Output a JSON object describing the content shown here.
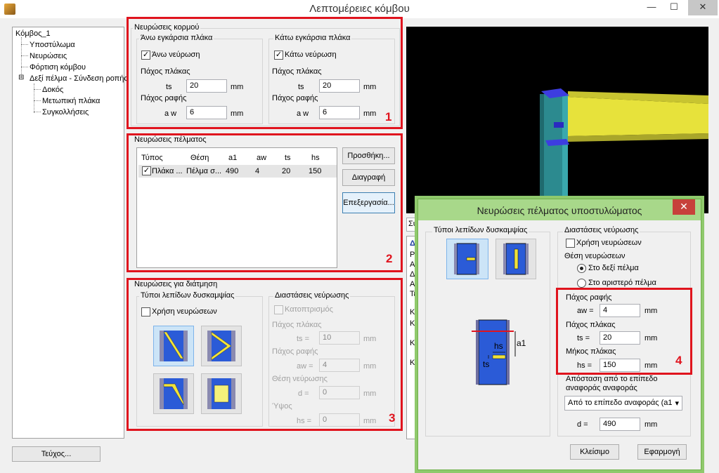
{
  "window": {
    "title": "Λεπτομέρειες κόμβου",
    "minimize": "—",
    "maximize": "☐",
    "close": "✕"
  },
  "tree": {
    "items": [
      "Κόμβος_1",
      "Υποστύλωμα",
      "Νευρώσεις",
      "Φόρτιση κόμβου",
      "Δεξί πέλμα - Σύνδεση ροπής",
      "Δοκός",
      "Μετωπική πλάκα",
      "Συγκολλήσεις"
    ],
    "expander": "⊟"
  },
  "footer": {
    "report_button": "Τεύχος..."
  },
  "web_stiffeners": {
    "title": "Νευρώσεις κορμού",
    "top": {
      "title": "Άνω εγκάρσια πλάκα",
      "checkbox": "Άνω νεύρωση",
      "checked": true,
      "thickness_label": "Πάχος πλάκας",
      "ts_label": "ts",
      "ts_value": "20",
      "ts_unit": "mm",
      "weld_label": "Πάχος ραφής",
      "aw_label": "a w",
      "aw_value": "6",
      "aw_unit": "mm"
    },
    "bottom": {
      "title": "Κάτω εγκάρσια πλάκα",
      "checkbox": "Κάτω νεύρωση",
      "checked": true,
      "thickness_label": "Πάχος πλάκας",
      "ts_label": "ts",
      "ts_value": "20",
      "ts_unit": "mm",
      "weld_label": "Πάχος ραφής",
      "aw_label": "a w",
      "aw_value": "6",
      "aw_unit": "mm"
    },
    "marker": "1"
  },
  "flange_stiffeners": {
    "title": "Νευρώσεις πέλματος",
    "columns": [
      "Τύπος",
      "Θέση",
      "a1",
      "aw",
      "ts",
      "hs"
    ],
    "rows": [
      {
        "type": "Πλάκα ...",
        "position": "Πέλμα σ...",
        "a1": "490",
        "aw": "4",
        "ts": "20",
        "hs": "150",
        "checked": true
      }
    ],
    "buttons": {
      "add": "Προσθήκη...",
      "delete": "Διαγραφή",
      "edit": "Επεξεργασία..."
    },
    "marker": "2"
  },
  "shear_stiffeners": {
    "title": "Νευρώσεις για διάτμηση",
    "types_title": "Τύποι λεπίδων δυσκαμψίας",
    "use_checkbox": "Χρήση νευρώσεων",
    "use_checked": false,
    "dims_title": "Διαστάσεις νεύρωσης",
    "mirror": "Κατοπτρισμός",
    "thickness_label": "Πάχος πλάκας",
    "ts_label": "ts =",
    "ts_value": "10",
    "ts_unit": "mm",
    "weld_label": "Πάχος ραφής",
    "aw_label": "aw =",
    "aw_value": "4",
    "aw_unit": "mm",
    "position_label": "Θέση νεύρωσης",
    "d_label": "d =",
    "d_value": "0",
    "d_unit": "mm",
    "height_label": "Ύψος",
    "hs_label": "hs =",
    "hs_value": "0",
    "hs_unit": "mm",
    "marker": "3"
  },
  "right_panel": {
    "combo_fragment": "Σύ",
    "lines": [
      "Δε",
      "Ρο",
      "Αξ",
      "Δι",
      "Αν",
      "Τέ",
      "Κα",
      "Κα",
      "Κρ",
      "Κρ"
    ]
  },
  "dialog": {
    "title": "Νευρώσεις πέλματος υποστυλώματος",
    "close": "✕",
    "types_title": "Τύποι λεπίδων δυσκαμψίας",
    "dims_title": "Διαστάσεις νεύρωσης",
    "use_checkbox": "Χρήση νευρώσεων",
    "use_checked": false,
    "position_title": "Θέση νευρώσεων",
    "radio_right": "Στο δεξί πέλμα",
    "radio_left": "Στο αριστερό πέλμα",
    "radio_selected": "right",
    "weld_label": "Πάχος ραφής",
    "aw_label": "aw =",
    "aw_value": "4",
    "aw_unit": "mm",
    "thickness_label": "Πάχος πλάκας",
    "ts_label": "ts =",
    "ts_value": "20",
    "ts_unit": "mm",
    "length_label": "Μήκος πλάκας",
    "hs_label": "hs =",
    "hs_value": "150",
    "hs_unit": "mm",
    "distance_label": "Απόσταση από το επίπεδο αναφοράς αναφοράς",
    "reference_select": "Από το επίπεδο αναφοράς (a1",
    "d_label": "d =",
    "d_value": "490",
    "d_unit": "mm",
    "diagram_labels": {
      "hs": "hs",
      "a1": "a1",
      "ts": "ts"
    },
    "buttons": {
      "close": "Κλείσιμο",
      "apply": "Εφαρμογή"
    },
    "marker": "4"
  },
  "colors": {
    "highlight_red": "#e0141e",
    "dialog_border": "#8fc96c",
    "dialog_title": "#a8d88a",
    "beam_yellow": "#e7e23b",
    "column_teal": "#2c8a8f"
  }
}
